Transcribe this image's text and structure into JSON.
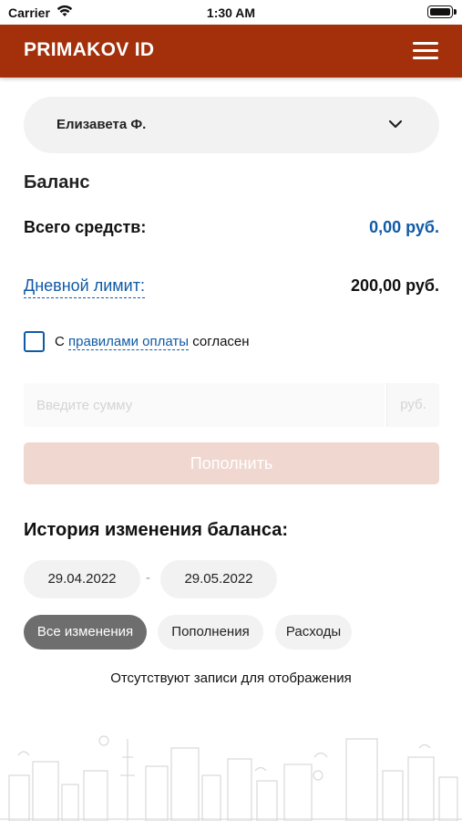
{
  "status_bar": {
    "carrier": "Carrier",
    "time": "1:30 AM"
  },
  "header": {
    "title": "PRIMAKOV ID",
    "menu_icon": "hamburger-menu-icon",
    "background": "#a3300b"
  },
  "user_select": {
    "name": "Елизавета Ф.",
    "icon": "chevron-down-icon"
  },
  "balance": {
    "title": "Баланс",
    "total_label": "Всего средств:",
    "total_value": "0,00 руб.",
    "daily_limit_label": "Дневной лимит:",
    "daily_limit_value": "200,00 руб.",
    "accent_color": "#0f5aa6"
  },
  "agreement": {
    "prefix": "С",
    "link": "правилами оплаты",
    "suffix": "согласен",
    "checked": false
  },
  "amount": {
    "placeholder": "Введите сумму",
    "currency": "руб."
  },
  "topup_button": {
    "label": "Пополнить",
    "enabled": false
  },
  "history": {
    "title": "История изменения баланса:",
    "date_from": "29.04.2022",
    "date_separator": "-",
    "date_to": "29.05.2022",
    "filters": [
      "Все изменения",
      "Пополнения",
      "Расходы"
    ],
    "active_filter": "Все изменения",
    "empty_message": "Отсутствуют записи для отображения"
  }
}
